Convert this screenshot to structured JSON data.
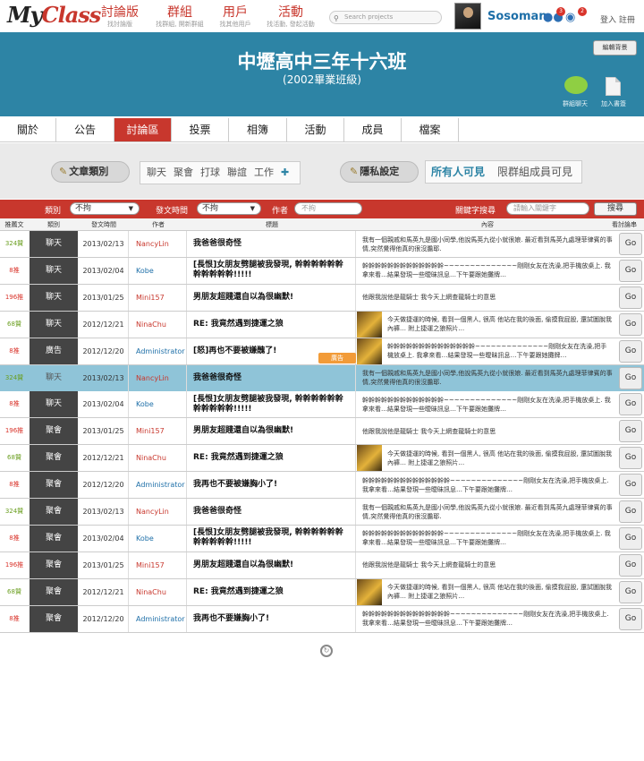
{
  "logo": {
    "my": "My",
    "class": "Class"
  },
  "nav": [
    {
      "label": "討論版",
      "sub": "找討論版"
    },
    {
      "label": "群組",
      "sub": "找群組, 開新群組"
    },
    {
      "label": "用戶",
      "sub": "找其他用戶"
    },
    {
      "label": "活動",
      "sub": "找活動, 發起活動"
    }
  ],
  "search": {
    "placeholder": "Search projects"
  },
  "user": {
    "name": "Sosoman",
    "friend_badge": "3",
    "msg_badge": "2",
    "auth": "登入 註冊"
  },
  "banner": {
    "title": "中壢高中三年十六班",
    "subtitle": "(2002畢業班級)",
    "edit_bg": "編輯背景",
    "chat_label": "群組聊天",
    "add_label": "加入書簽"
  },
  "tabs": [
    "關於",
    "公告",
    "討論區",
    "投票",
    "相簿",
    "活動",
    "成員",
    "檔案"
  ],
  "filters": {
    "category_btn": "文章類別",
    "categories": [
      "聊天",
      "聚會",
      "打球",
      "聯誼",
      "工作"
    ],
    "privacy_btn": "隱私設定",
    "visibility": [
      "所有人可見",
      "限群組成員可見"
    ]
  },
  "searchbar": {
    "cat_label": "類別",
    "cat_value": "不拘",
    "time_label": "發文時間",
    "time_value": "不拘",
    "author_label": "作者",
    "author_placeholder": "不拘",
    "keyword_label": "關鍵字搜尋",
    "keyword_placeholder": "請輸入關鍵字",
    "search_btn": "搜尋"
  },
  "columns": [
    "推薦文",
    "類別",
    "發文時間",
    "作者",
    "標題",
    "內容",
    "看討論串"
  ],
  "ad_label": "廣告",
  "go_label": "Go",
  "rows": [
    {
      "n": "324贊",
      "cat": "聊天",
      "date": "2013/02/13",
      "author": "NancyLin",
      "title": "我爸爸很奇怪",
      "content": "我有一個親戚和馬英九是國小同學,他說馬英九從小就很娘. 最近看到馬英九處理菲律賓的事情,突然覺得他真的很沒膽耶.",
      "thumb": false
    },
    {
      "n": "8推",
      "cat": "聊天",
      "date": "2013/02/04",
      "author": "Kobe",
      "title": "[長恨]女朋友劈腿被我發現, 幹幹幹幹幹幹幹幹幹幹幹!!!!!",
      "content": "幹幹幹幹幹幹幹幹幹幹幹幹幹~~~~~~~~~~~~~~剛剛女友在洗澡,把手機放桌上. 我拿來看…結果發現一些曖昧訊息…下午要跟她攤牌…",
      "thumb": false
    },
    {
      "n": "196推",
      "cat": "聊天",
      "date": "2013/01/25",
      "author": "Mini157",
      "title": "男朋友超賤還自以為很幽默!",
      "content": "他跟我說他是龍騎士 我今天上網查龍騎士的意思",
      "thumb": false
    },
    {
      "n": "68贊",
      "cat": "聊天",
      "date": "2012/12/21",
      "author": "NinaChu",
      "title": "RE: 我竟然遇到捷運之狼",
      "content": "今天做捷運的時候, 看到一個黑人, 很高 他站在我的後面, 偷摸我屁股, 還試圖脫我內褲… 附上捷運之狼照片…",
      "thumb": true
    },
    {
      "n": "8推",
      "cat": "廣告",
      "date": "2012/12/20",
      "author": "Administrator",
      "title": "[怒]再也不要被嫌醜了!",
      "content": "幹幹幹幹幹幹幹幹幹幹幹幹幹幹~~~~~~~~~~~~~~剛剛女友在洗澡,把手機放桌上. 我拿來看…結果發現一些曖昧訊息…下午要跟她攤牌…",
      "thumb": true,
      "ad": true
    },
    {
      "n": "324贊",
      "cat": "聊天",
      "date": "2013/02/13",
      "author": "NancyLin",
      "title": "我爸爸很奇怪",
      "content": "我有一個親戚和馬英九是國小同學,他說馬英九從小就很娘. 最近看到馬英九處理菲律賓的事情,突然覺得他真的很沒膽耶.",
      "thumb": false,
      "hl": true
    },
    {
      "n": "8推",
      "cat": "聊天",
      "date": "2013/02/04",
      "author": "Kobe",
      "title": "[長恨]女朋友劈腿被我發現, 幹幹幹幹幹幹幹幹幹幹幹!!!!!",
      "content": "幹幹幹幹幹幹幹幹幹幹幹幹幹~~~~~~~~~~~~~~剛剛女友在洗澡,把手機放桌上. 我拿來看…結果發現一些曖昧訊息…下午要跟她攤牌…",
      "thumb": false
    },
    {
      "n": "196推",
      "cat": "聚會",
      "date": "2013/01/25",
      "author": "Mini157",
      "title": "男朋友超賤還自以為很幽默!",
      "content": "他跟我說他是龍騎士 我今天上網查龍騎士的意思",
      "thumb": false
    },
    {
      "n": "68贊",
      "cat": "聚會",
      "date": "2012/12/21",
      "author": "NinaChu",
      "title": "RE: 我竟然遇到捷運之狼",
      "content": "今天做捷運的時候, 看到一個黑人, 很高 他站在我的後面, 偷摸我屁股, 還試圖脫我內褲… 附上捷運之狼照片…",
      "thumb": true
    },
    {
      "n": "8推",
      "cat": "聚會",
      "date": "2012/12/20",
      "author": "Administrator",
      "title": "我再也不要被嫌胸小了!",
      "content": "幹幹幹幹幹幹幹幹幹幹幹幹幹幹~~~~~~~~~~~~~~剛剛女友在洗澡,把手機放桌上. 我拿來看…結果發現一些曖昧訊息…下午要跟她攤牌…",
      "thumb": false
    },
    {
      "n": "324贊",
      "cat": "聚會",
      "date": "2013/02/13",
      "author": "NancyLin",
      "title": "我爸爸很奇怪",
      "content": "我有一個親戚和馬英九是國小同學,他說馬英九從小就很娘. 最近看到馬英九處理菲律賓的事情,突然覺得他真的很沒膽耶.",
      "thumb": false
    },
    {
      "n": "8推",
      "cat": "聚會",
      "date": "2013/02/04",
      "author": "Kobe",
      "title": "[長恨]女朋友劈腿被我發現, 幹幹幹幹幹幹幹幹幹幹幹!!!!!",
      "content": "幹幹幹幹幹幹幹幹幹幹幹幹幹~~~~~~~~~~~~~~剛剛女友在洗澡,把手機放桌上. 我拿來看…結果發現一些曖昧訊息…下午要跟她攤牌…",
      "thumb": false
    },
    {
      "n": "196推",
      "cat": "聚會",
      "date": "2013/01/25",
      "author": "Mini157",
      "title": "男朋友超賤還自以為很幽默!",
      "content": "他跟我說他是龍騎士 我今天上網查龍騎士的意思",
      "thumb": false
    },
    {
      "n": "68贊",
      "cat": "聚會",
      "date": "2012/12/21",
      "author": "NinaChu",
      "title": "RE: 我竟然遇到捷運之狼",
      "content": "今天做捷運的時候, 看到一個黑人, 很高 他站在我的後面, 偷摸我屁股, 還試圖脫我內褲… 附上捷運之狼照片…",
      "thumb": true
    },
    {
      "n": "8推",
      "cat": "聚會",
      "date": "2012/12/20",
      "author": "Administrator",
      "title": "我再也不要嫌胸小了!",
      "content": "幹幹幹幹幹幹幹幹幹幹幹幹幹幹~~~~~~~~~~~~~~剛剛女友在洗澡,把手機放桌上. 我拿來看…結果發現一些曖昧訊息…下午要跟她攤牌…",
      "thumb": false
    }
  ],
  "colors": {
    "brand_red": "#c8372d",
    "banner_blue": "#2d84a5",
    "author_female": "#c8372d",
    "author_male": "#1e6fa8",
    "count_green": "#6a9e1f",
    "count_red": "#d9342b"
  }
}
